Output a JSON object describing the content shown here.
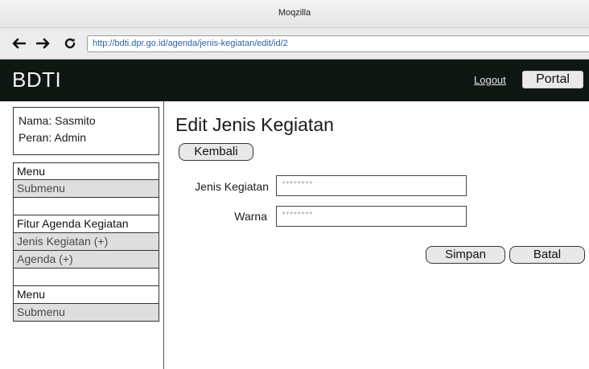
{
  "window": {
    "title": "Moqzilla"
  },
  "browser": {
    "url": "http://bdti.dpr.go.id/agenda/jenis-kegiatan/edit/id/2",
    "back_icon": "arrow-left-icon",
    "forward_icon": "arrow-right-icon",
    "reload_icon": "reload-icon"
  },
  "header": {
    "brand": "BDTI",
    "logout_label": "Logout",
    "portal_label": "Portal"
  },
  "user": {
    "name_line": "Nama: Sasmito",
    "role_line": "Peran: Admin"
  },
  "sidebar": {
    "group1": {
      "header": "Menu",
      "items": [
        "Submenu"
      ]
    },
    "group2": {
      "header": "Fitur Agenda Kegiatan",
      "items": [
        "Jenis Kegiatan (+)",
        "Agenda (+)"
      ]
    },
    "group3": {
      "header": "Menu",
      "items": [
        "Submenu"
      ]
    }
  },
  "main": {
    "title": "Edit Jenis Kegiatan",
    "back_label": "Kembali",
    "fields": [
      {
        "label": "Jenis Kegiatan",
        "value": "********"
      },
      {
        "label": "Warna",
        "value": "********"
      }
    ],
    "save_label": "Simpan",
    "cancel_label": "Batal"
  },
  "colors": {
    "header_bg": "#0f1713",
    "submenu_bg": "#dedede",
    "url_text": "#2c5fa8"
  }
}
